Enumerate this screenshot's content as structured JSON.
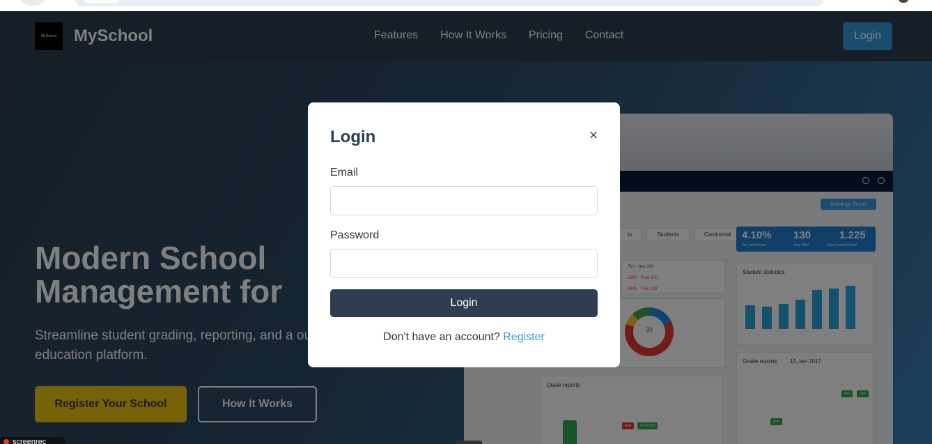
{
  "brand": {
    "logo_text": "MySchool",
    "name": "MySchool"
  },
  "nav": {
    "links": [
      "Features",
      "How It Works",
      "Pricing",
      "Contact"
    ],
    "login_label": "Login"
  },
  "hero": {
    "title": "Modern School Management for",
    "subtitle": "Streamline student grading, reporting, and a our all-in-one education platform.",
    "register_label": "Register Your School",
    "how_label": "How It Works"
  },
  "dashboard": {
    "secure_label": "Schwinge Secort",
    "tabs": [
      "ts",
      "Students",
      "Cantionnel"
    ],
    "stats": [
      {
        "value": "4.10%",
        "label": "Der Cal Heease"
      },
      {
        "value": "130",
        "label": "Stee Offel"
      },
      {
        "value": "1.225",
        "label": "Care Cuoice Entool"
      }
    ],
    "student_stats_title": "Student statistics",
    "grade_reports_title": "Grade reports",
    "grade_reports_date": "10, ber 2017",
    "detail_reports_title": "Dtaile reports",
    "donut_value": "39"
  },
  "modal": {
    "title": "Login",
    "close_icon": "close-icon",
    "email_label": "Email",
    "email_value": "",
    "password_label": "Password",
    "password_value": "",
    "submit_label": "Login",
    "register_prompt": "Don't have an account?",
    "register_link": "Register"
  },
  "recorder": {
    "label": "screenrec"
  },
  "colors": {
    "primary": "#2c3e50",
    "accent": "#3498db",
    "yellow": "#f1c40f"
  }
}
